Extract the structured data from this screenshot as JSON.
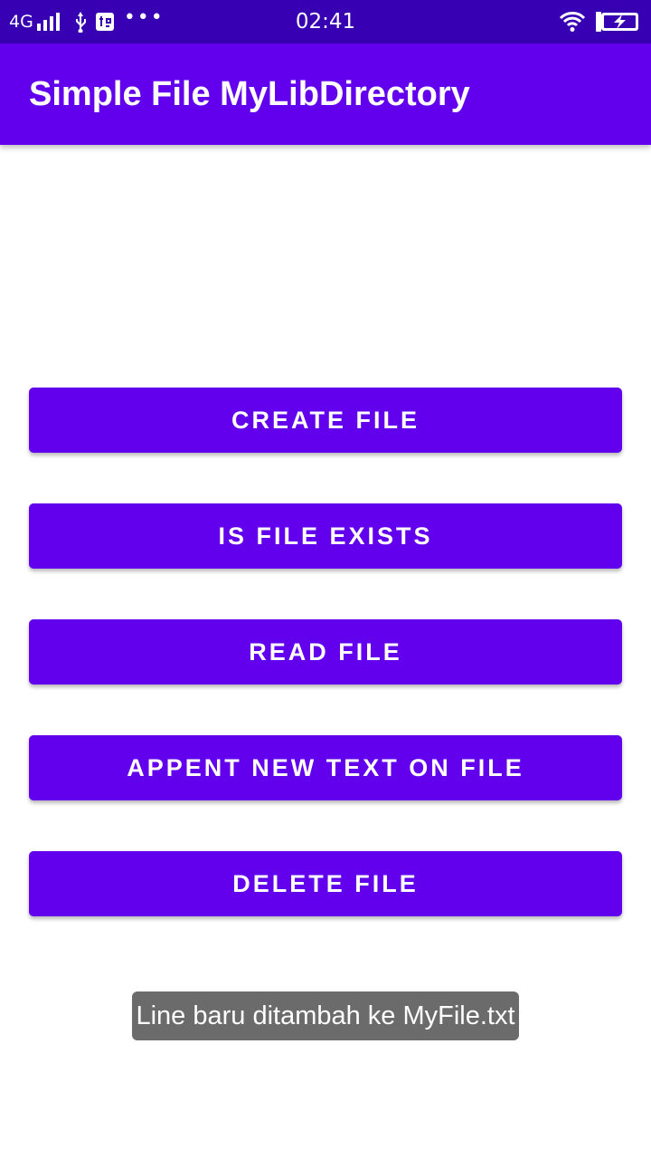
{
  "status_bar": {
    "network": "4G",
    "time": "02:41",
    "icons": [
      "signal-icon",
      "usb-icon",
      "usb-debug-icon",
      "more-icon",
      "wifi-icon",
      "battery-charging-icon"
    ],
    "dots": "•••"
  },
  "app_bar": {
    "title": "Simple File MyLibDirectory"
  },
  "buttons": [
    {
      "label": "CREATE FILE"
    },
    {
      "label": "IS FILE EXISTS"
    },
    {
      "label": "READ FILE"
    },
    {
      "label": "APPENT NEW TEXT ON FILE"
    },
    {
      "label": "DELETE FILE"
    }
  ],
  "toast": {
    "message": "Line baru ditambah ke MyFile.txt"
  },
  "colors": {
    "status_bar": "#3700B3",
    "primary": "#6200EE",
    "toast": "#6b6b6b"
  }
}
